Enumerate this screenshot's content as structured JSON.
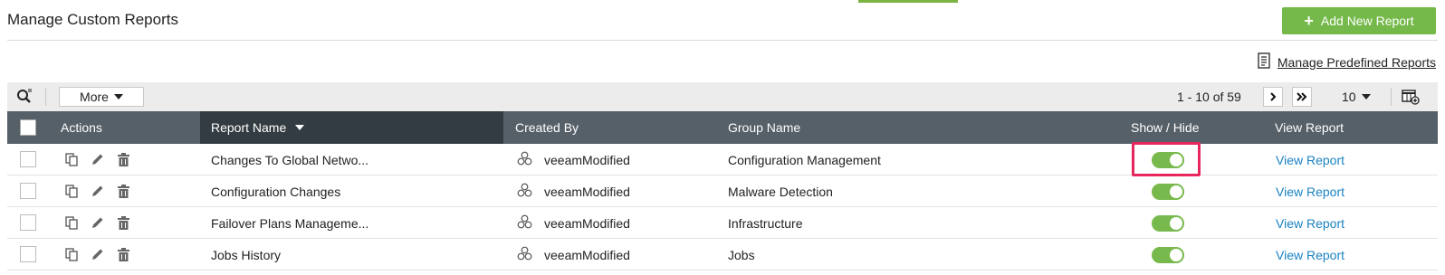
{
  "page": {
    "title": "Manage Custom Reports"
  },
  "header": {
    "add_button_label": "Add New Report",
    "predefined_link": "Manage Predefined Reports"
  },
  "toolbar": {
    "more_label": "More",
    "page_range": "1 - 10 of 59",
    "per_page": "10"
  },
  "table": {
    "columns": {
      "actions": "Actions",
      "report_name": "Report Name",
      "created_by": "Created By",
      "group_name": "Group Name",
      "show_hide": "Show / Hide",
      "view_report": "View Report"
    },
    "rows": [
      {
        "report_name": "Changes To Global Netwo...",
        "created_by": "veeamModified",
        "group_name": "Configuration Management",
        "shown": true,
        "view_label": "View Report"
      },
      {
        "report_name": "Configuration Changes",
        "created_by": "veeamModified",
        "group_name": "Malware Detection",
        "shown": true,
        "view_label": "View Report"
      },
      {
        "report_name": "Failover Plans Manageme...",
        "created_by": "veeamModified",
        "group_name": "Infrastructure",
        "shown": true,
        "view_label": "View Report"
      },
      {
        "report_name": "Jobs History",
        "created_by": "veeamModified",
        "group_name": "Jobs",
        "shown": true,
        "view_label": "View Report"
      }
    ]
  },
  "colors": {
    "accent_green": "#74b94a",
    "header_bg": "#566068",
    "sorted_header_bg": "#333c42",
    "link_blue": "#1a82c4",
    "highlight": "#e8265e"
  },
  "icons": [
    "search-icon",
    "caret-down-icon",
    "next-page-icon",
    "last-page-icon",
    "column-chooser-icon",
    "report-doc-icon",
    "copy-icon",
    "edit-icon",
    "delete-icon",
    "user-group-icon"
  ]
}
